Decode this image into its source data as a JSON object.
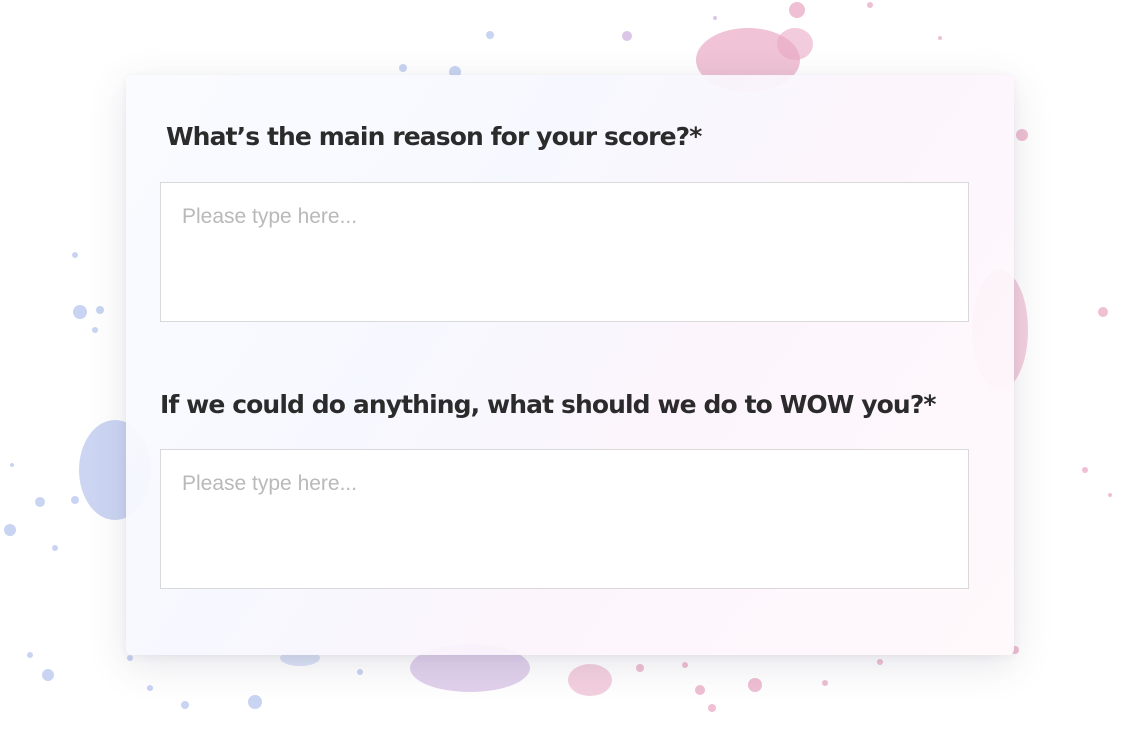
{
  "theme": {
    "splatter_blue": "#b6c5ee",
    "splatter_pink": "#e9a9c4",
    "splatter_lilac": "#cdb3df",
    "question_color": "#2b2b2b",
    "placeholder_color": "#b9b9b9",
    "field_border": "#d9d9d9"
  },
  "form": {
    "questions": [
      {
        "label": "What’s the main reason for your score?*",
        "placeholder": "Please type here...",
        "value": ""
      },
      {
        "label": "If we could do anything, what should we do to WOW you?*",
        "placeholder": "Please type here...",
        "value": ""
      }
    ]
  }
}
